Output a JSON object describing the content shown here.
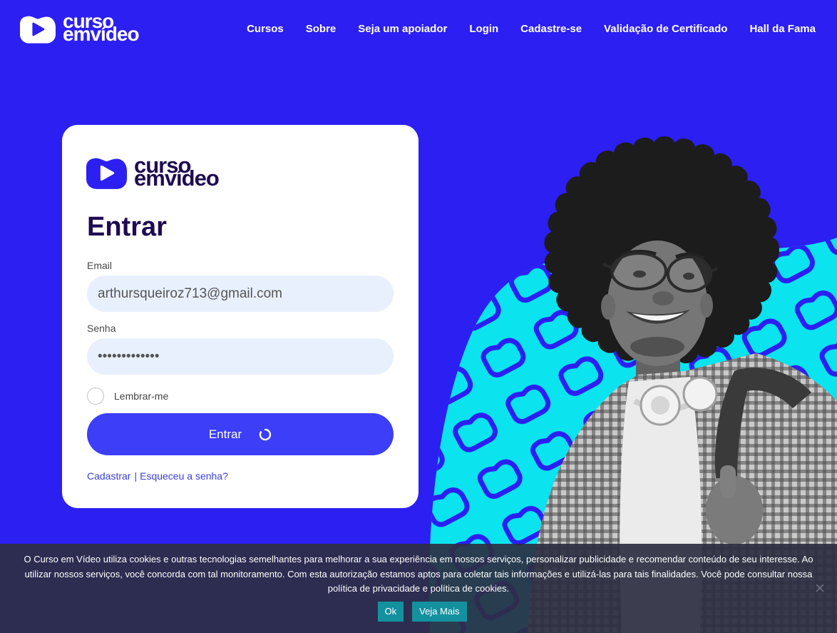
{
  "header": {
    "logo": {
      "line1": "curso",
      "line2_em": "em",
      "line2_video": "vídeo",
      "icon": "play-logo-icon"
    },
    "nav": [
      {
        "label": "Cursos"
      },
      {
        "label": "Sobre"
      },
      {
        "label": "Seja um apoiador"
      },
      {
        "label": "Login"
      },
      {
        "label": "Cadastre-se"
      },
      {
        "label": "Validação de Certificado"
      },
      {
        "label": "Hall da Fama"
      }
    ]
  },
  "login_card": {
    "logo": {
      "line1": "curso",
      "line2_em": "em",
      "line2_video": "vídeo",
      "icon": "play-logo-icon"
    },
    "title": "Entrar",
    "email": {
      "label": "Email",
      "value": "arthursqueiroz713@gmail.com"
    },
    "password": {
      "label": "Senha",
      "value": "•••••••••••••"
    },
    "remember": {
      "label": "Lembrar-me",
      "checked": false
    },
    "submit": {
      "label": "Entrar",
      "loading": true,
      "icon": "spinner-icon"
    },
    "links": {
      "register": "Cadastrar",
      "separator": "|",
      "forgot": "Esqueceu a senha?"
    }
  },
  "cookie_banner": {
    "text": "O Curso em Vídeo utiliza cookies e outras tecnologias semelhantes para melhorar a sua experiência em nossos serviços, personalizar publicidade e recomendar conteúdo de seu interesse. Ao utilizar nossos serviços, você concorda com tal monitoramento. Com esta autorização estamos aptos para coletar tais informações e utilizá-las para tais finalidades. Você pode consultar nossa política de privacidade e política de cookies.",
    "ok_label": "Ok",
    "more_label": "Veja Mais",
    "close_icon": "close-icon"
  },
  "colors": {
    "brand_blue": "#2c1ff2",
    "button_blue": "#3c3ef8",
    "cyan": "#0be3ef",
    "title_dark": "#1e0b52",
    "link": "#3a3fd9",
    "cookie_button": "#14919f",
    "autofill_bg": "#e8f0fe"
  }
}
